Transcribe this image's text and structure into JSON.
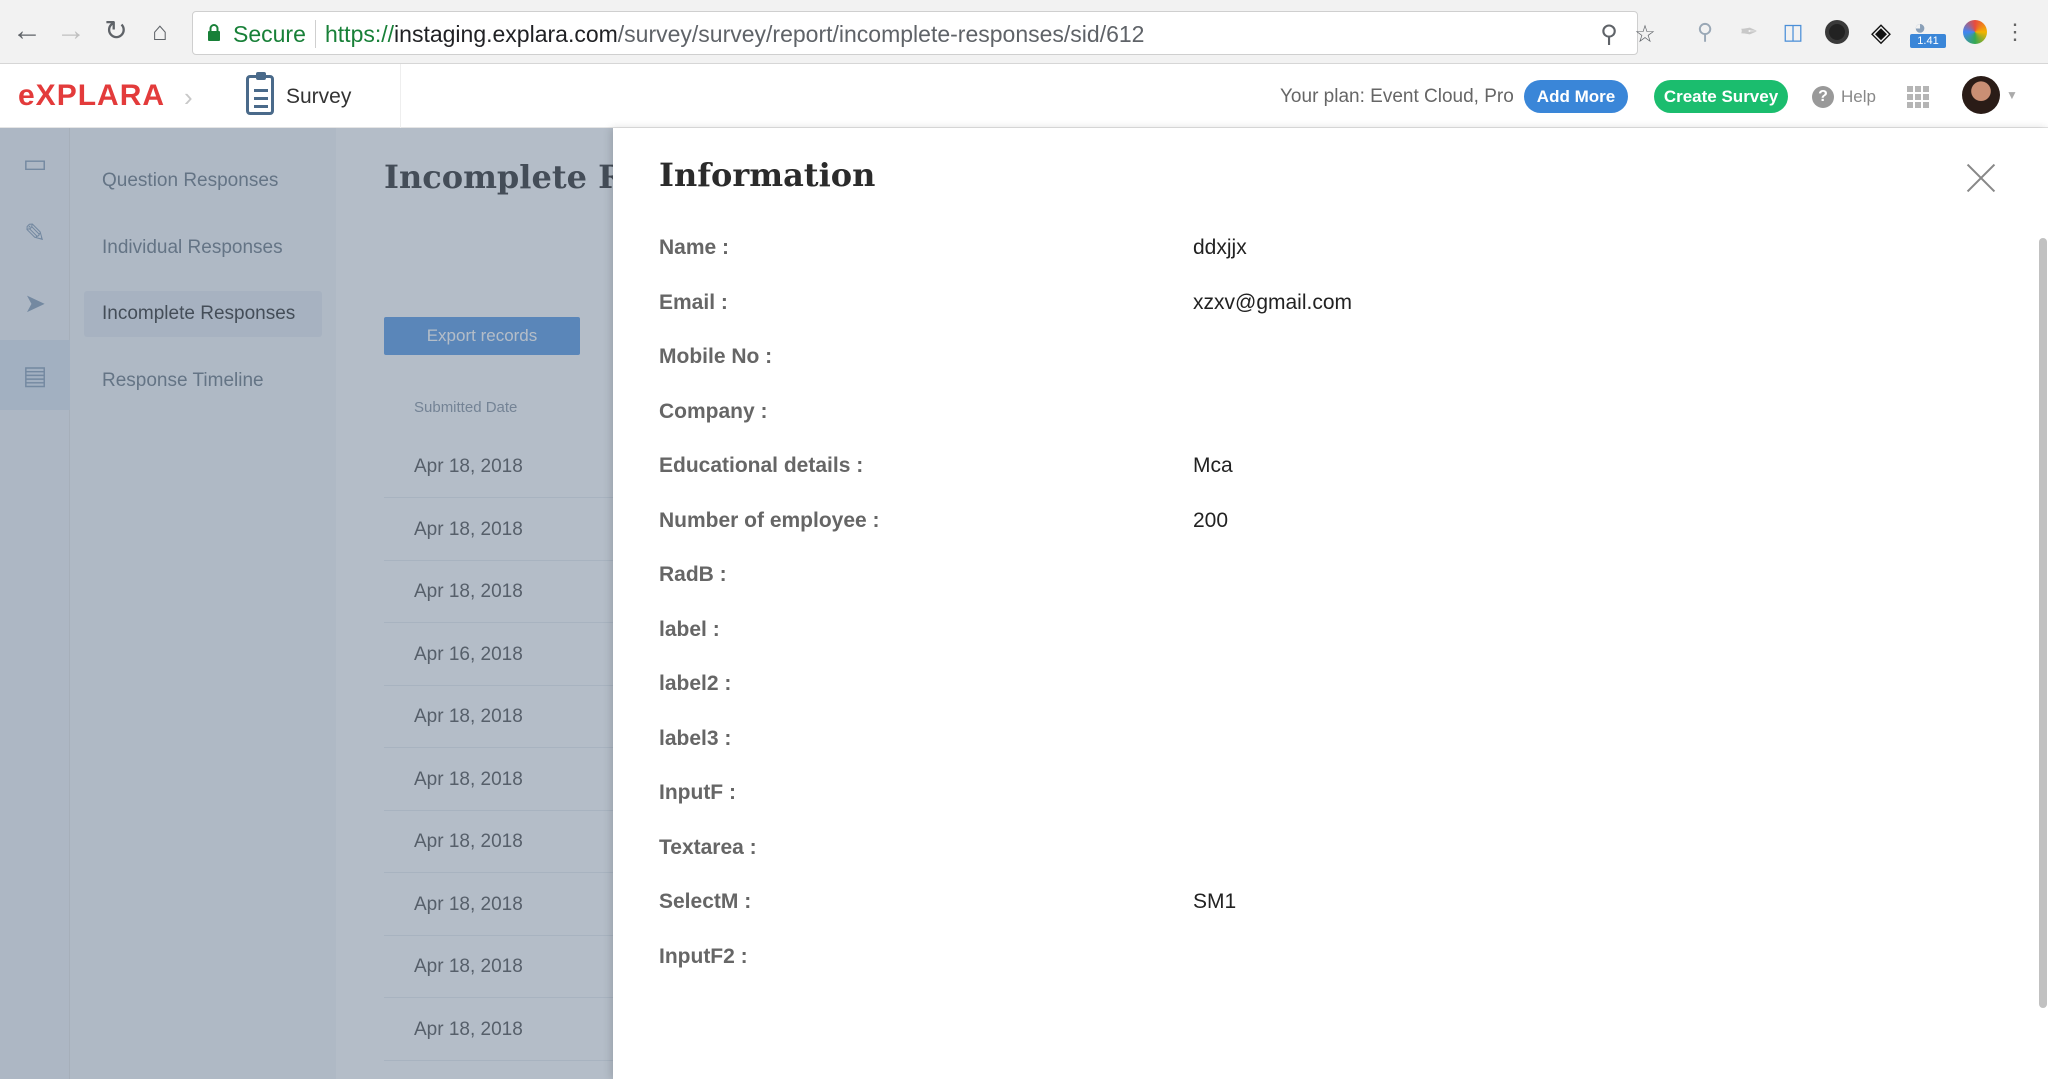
{
  "browser": {
    "secure_label": "Secure",
    "url_scheme": "https://",
    "url_host": "instaging.explara.com",
    "url_path": "/survey/survey/report/incomplete-responses/sid/612",
    "ext_badge": "1.41"
  },
  "header": {
    "logo": "eXPLARA",
    "module_label": "Survey",
    "plan_text": "Your plan: Event Cloud, Pro",
    "add_more_label": "Add More",
    "create_survey_label": "Create Survey",
    "help_label": "Help"
  },
  "sidebar": {
    "items": [
      {
        "label": "Question Responses"
      },
      {
        "label": "Individual Responses"
      },
      {
        "label": "Incomplete Responses"
      },
      {
        "label": "Response Timeline"
      }
    ]
  },
  "main": {
    "title": "Incomplete Res",
    "export_label": "Export records",
    "column_header": "Submitted Date",
    "dates": [
      "Apr 18, 2018",
      "Apr 18, 2018",
      "Apr 18, 2018",
      "Apr 16, 2018",
      "Apr 18, 2018",
      "Apr 18, 2018",
      "Apr 18, 2018",
      "Apr 18, 2018",
      "Apr 18, 2018",
      "Apr 18, 2018"
    ]
  },
  "panel": {
    "title": "Information",
    "fields": [
      {
        "label": "Name :",
        "value": "ddxjjx"
      },
      {
        "label": "Email :",
        "value": "xzxv@gmail.com"
      },
      {
        "label": "Mobile No :",
        "value": ""
      },
      {
        "label": "Company :",
        "value": ""
      },
      {
        "label": "Educational details :",
        "value": "Mca"
      },
      {
        "label": "Number of employee :",
        "value": "200"
      },
      {
        "label": "RadB :",
        "value": ""
      },
      {
        "label": "label :",
        "value": ""
      },
      {
        "label": "label2 :",
        "value": ""
      },
      {
        "label": "label3 :",
        "value": ""
      },
      {
        "label": "InputF :",
        "value": ""
      },
      {
        "label": "Textarea :",
        "value": ""
      },
      {
        "label": "SelectM :",
        "value": "SM1"
      },
      {
        "label": "InputF2 :",
        "value": ""
      }
    ]
  },
  "colors": {
    "brand": "#e33b3b",
    "add_more": "#3a86d8",
    "create_survey": "#1bbd6e",
    "export": "#5c9be3"
  }
}
